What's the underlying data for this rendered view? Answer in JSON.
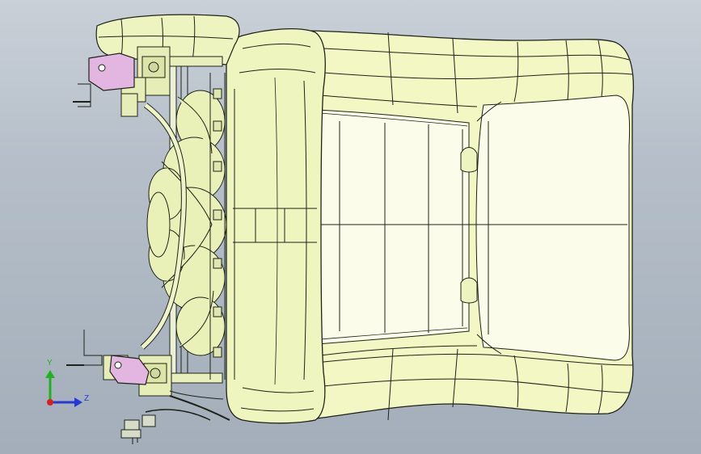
{
  "viewport": {
    "background_top": "#c9d0d8",
    "background_bottom": "#a3aeba"
  },
  "model": {
    "part": "seat-assembly",
    "surface_color": "#f2f7c4",
    "edge_color": "#1e2218",
    "bracket_color": "#e3b6e1"
  },
  "triad": {
    "y_label": "Y",
    "z_label": "Z",
    "y_color": "#1eb21e",
    "z_color": "#2838d8",
    "origin_color": "#d82020"
  }
}
